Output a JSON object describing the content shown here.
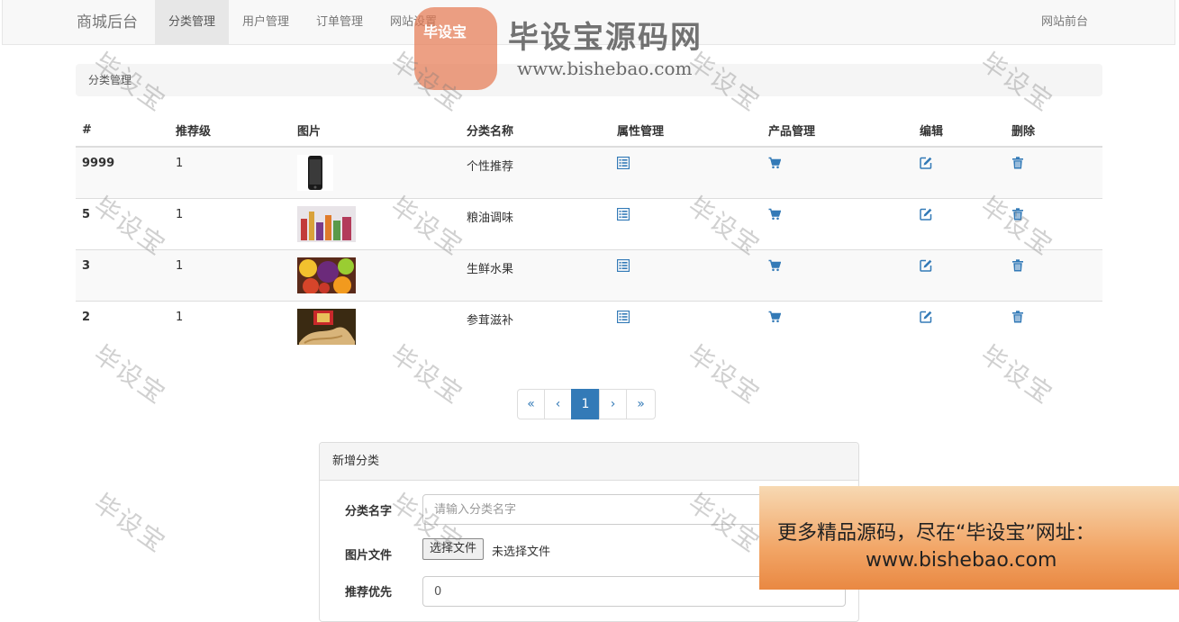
{
  "nav": {
    "brand": "商城后台",
    "items": [
      "分类管理",
      "用户管理",
      "订单管理",
      "网站设置"
    ],
    "active_index": 0,
    "right_link": "网站前台"
  },
  "breadcrumb": "分类管理",
  "table": {
    "headers": [
      "#",
      "推荐级",
      "图片",
      "分类名称",
      "属性管理",
      "产品管理",
      "编辑",
      "删除"
    ],
    "rows": [
      {
        "id": "9999",
        "level": "1",
        "image": "phone",
        "name": "个性推荐"
      },
      {
        "id": "5",
        "level": "1",
        "image": "condiments",
        "name": "粮油调味"
      },
      {
        "id": "3",
        "level": "1",
        "image": "fruit",
        "name": "生鲜水果"
      },
      {
        "id": "2",
        "level": "1",
        "image": "ginseng",
        "name": "参茸滋补"
      }
    ],
    "icons": {
      "attributes": "list-icon",
      "products": "cart-icon",
      "edit": "edit-icon",
      "delete": "trash-icon"
    }
  },
  "pagination": {
    "first": "«",
    "prev": "‹",
    "current": "1",
    "next": "›",
    "last": "»"
  },
  "add_panel": {
    "title": "新增分类",
    "name_label": "分类名字",
    "name_placeholder": "请输入分类名字",
    "file_label": "图片文件",
    "file_button": "选择文件",
    "file_status": "未选择文件",
    "level_label": "推荐优先",
    "level_value": "0"
  },
  "watermark": {
    "text": "毕设宝",
    "logo_badge": "毕设宝",
    "logo_title": "毕设宝源码网",
    "logo_url": "www.bishebao.com"
  },
  "promo": {
    "line1": "更多精品源码，尽在“毕设宝”网址：",
    "line2": "www.bishebao.com"
  },
  "colors": {
    "accent": "#337ab7",
    "navbar_bg": "#f8f8f8",
    "stripe": "#f9f9f9"
  }
}
